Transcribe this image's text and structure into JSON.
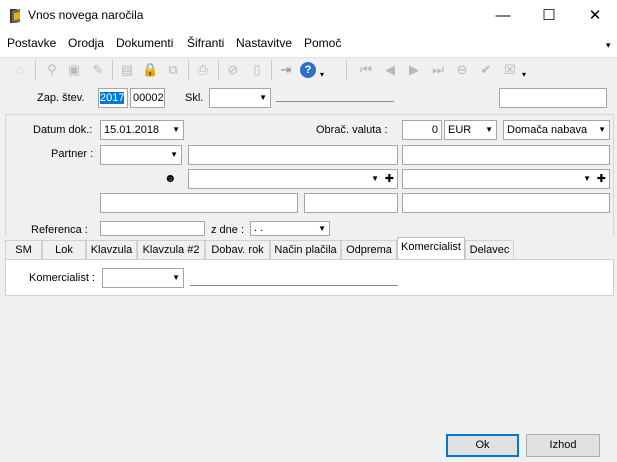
{
  "window": {
    "title": "Vnos novega naročila",
    "minimize": "—",
    "maximize": "☐",
    "close": "✕"
  },
  "menu": {
    "items": [
      "Postavke",
      "Orodja",
      "Dokumenti",
      "Šifranti",
      "Nastavitve",
      "Pomoč"
    ],
    "overflow": "▾"
  },
  "toolbar": {
    "icons": [
      "refresh-icon",
      "pin-icon",
      "save-icon",
      "erase-icon",
      "delete-icon",
      "lock-icon",
      "copy-icon",
      "print-icon",
      "attach-icon",
      "document-icon",
      "export-icon",
      "help-icon",
      "first-icon",
      "prev-icon",
      "next-icon",
      "last-icon",
      "cancel-icon",
      "confirm-icon",
      "close-doc-icon"
    ]
  },
  "form": {
    "zap_stev_label": "Zap. štev.",
    "year": "2017",
    "number": "00002",
    "skl_label": "Skl.",
    "skl_value": "",
    "datum_label": "Datum dok.:",
    "datum_value": "15.01.2018",
    "valuta_label": "Obrač. valuta :",
    "valuta_amount": "0",
    "valuta_code": "EUR",
    "nabava": "Domača nabava",
    "partner_label": "Partner :",
    "referenca_label": "Referenca  :",
    "z_dne_label": "z dne :",
    "z_dne_value": " . ."
  },
  "tabs": [
    "SM",
    "Lok",
    "Klavzula",
    "Klavzula #2",
    "Dobav. rok",
    "Način plačila",
    "Odprema",
    "Komercialist",
    "Delavec"
  ],
  "active_tab": "Komercialist",
  "tab_content": {
    "komercialist_label": "Komercialist :",
    "komercialist_value": ""
  },
  "buttons": {
    "ok": "Ok",
    "exit": "Izhod"
  }
}
